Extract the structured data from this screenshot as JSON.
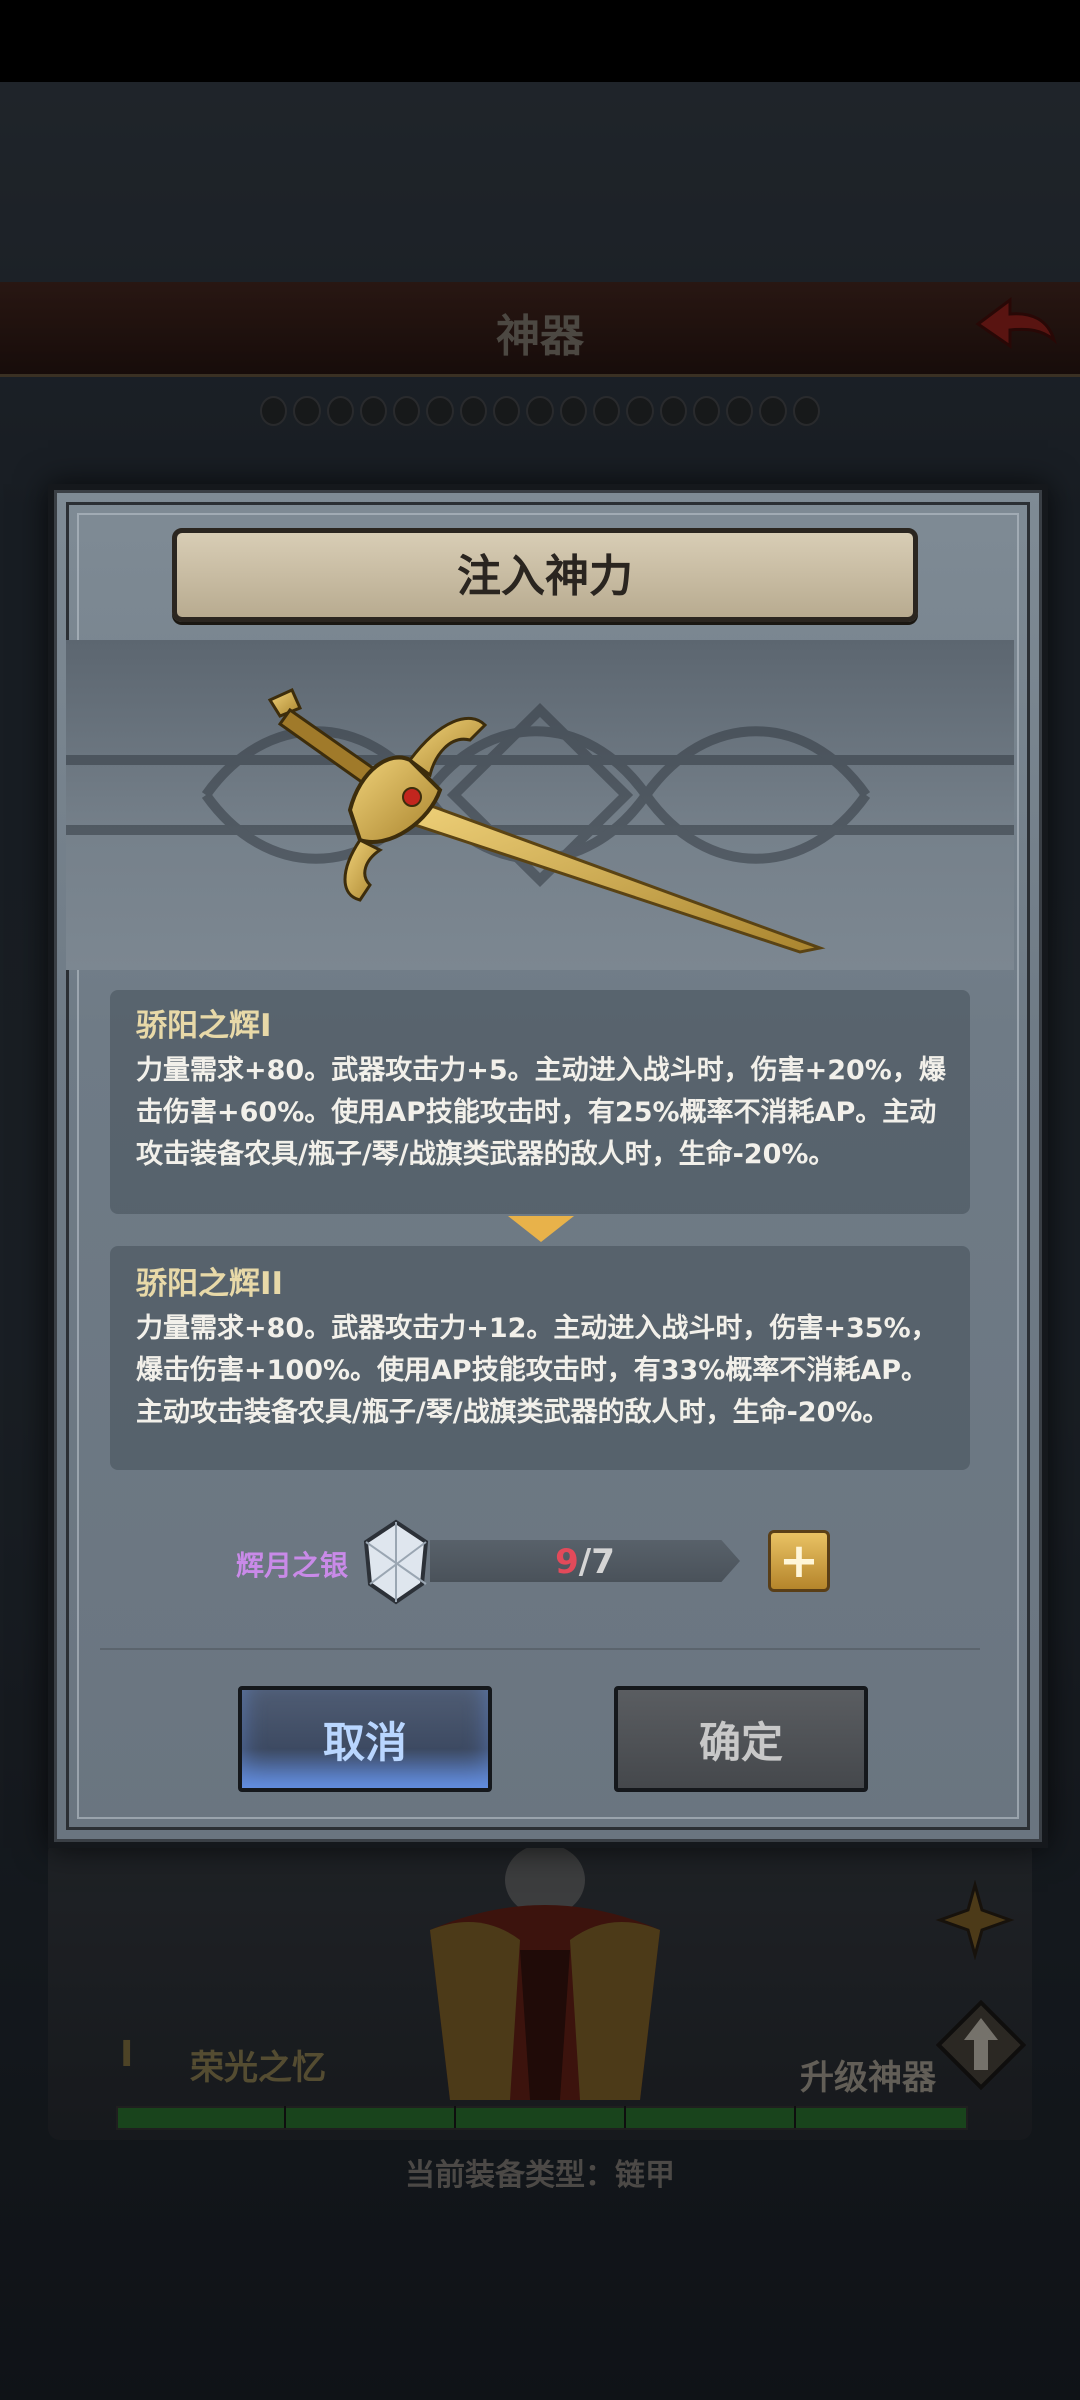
{
  "screen": {
    "title": "神器",
    "equip_type_text": "当前装备类型：链甲",
    "artifact_level": "I",
    "artifact_name": "荣光之忆",
    "upgrade_label": "升级神器",
    "progress_fraction": 1.0
  },
  "dialog": {
    "title": "注入神力",
    "current": {
      "name": "骄阳之辉I",
      "desc": "力量需求+80。武器攻击力+5。主动进入战斗时，伤害+20%，爆击伤害+60%。使用AP技能攻击时，有25%概率不消耗AP。主动攻击装备农具/瓶子/琴/战旗类武器的敌人时，生命-20%。"
    },
    "next": {
      "name": "骄阳之辉II",
      "desc": "力量需求+80。武器攻击力+12。主动进入战斗时，伤害+35%，爆击伤害+100%。使用AP技能攻击时，有33%概率不消耗AP。主动攻击装备农具/瓶子/琴/战旗类武器的敌人时，生命-20%。"
    },
    "material": {
      "name": "辉月之银",
      "have": "9",
      "sep": "/",
      "need": "7"
    },
    "cancel_label": "取消",
    "confirm_label": "确定"
  },
  "colors": {
    "skill_name": "#e8d9a8",
    "material_name": "#c98ae8",
    "have_count": "#e24a5a",
    "cancel_text": "#b9d6ff"
  },
  "icons": [
    "back-arrow-icon",
    "sword-icon",
    "silver-crystal-icon",
    "plus-icon",
    "dropdown-arrow-icon",
    "artifact-icon",
    "upgrade-arrow-icon"
  ]
}
